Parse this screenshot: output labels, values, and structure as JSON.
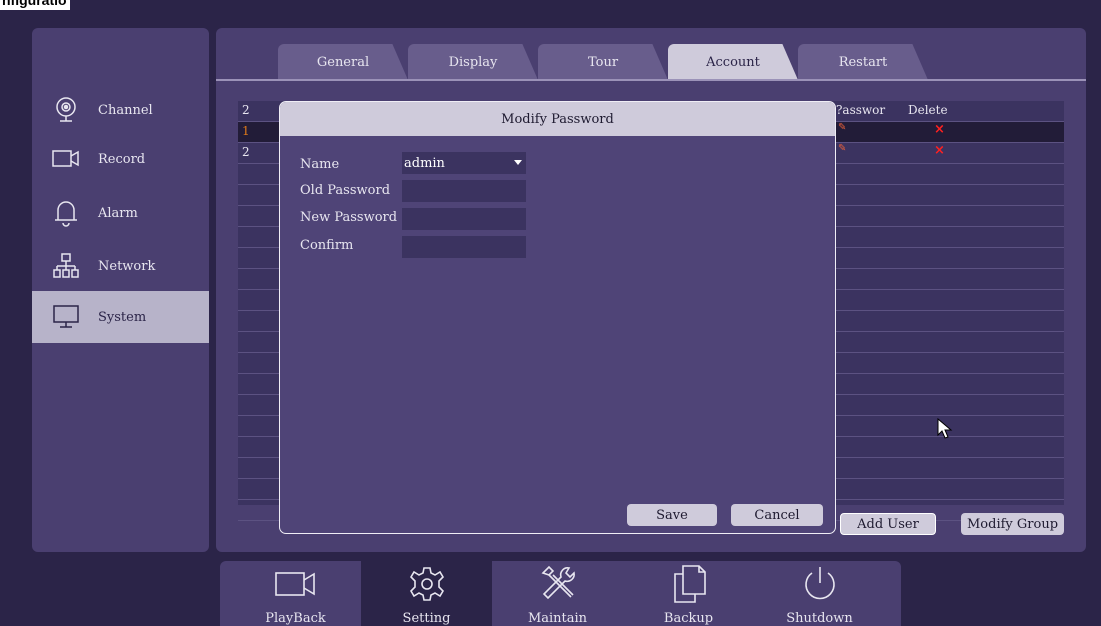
{
  "top_label": "nfiguratio",
  "sidebar": {
    "items": [
      {
        "label": "Channel",
        "icon": "webcam-icon"
      },
      {
        "label": "Record",
        "icon": "video-camera-icon"
      },
      {
        "label": "Alarm",
        "icon": "bell-icon"
      },
      {
        "label": "Network",
        "icon": "network-icon"
      },
      {
        "label": "System",
        "icon": "monitor-icon",
        "active": true
      }
    ]
  },
  "tabs": [
    {
      "label": "General"
    },
    {
      "label": "Display"
    },
    {
      "label": "Tour"
    },
    {
      "label": "Account",
      "active": true
    },
    {
      "label": "Restart"
    }
  ],
  "table": {
    "header": {
      "index": "2",
      "password_col": "?asswor",
      "delete_col": "Delete"
    },
    "rows": [
      {
        "index": "1",
        "selected": true,
        "has_edit": true,
        "delete": "×"
      },
      {
        "index": "2",
        "selected": false,
        "has_edit": true,
        "delete": "×"
      }
    ]
  },
  "buttons": {
    "add_user": "Add User",
    "modify_group": "Modify Group"
  },
  "modal": {
    "title": "Modify Password",
    "name_label": "Name",
    "name_value": "admin",
    "old_password_label": "Old Password",
    "new_password_label": "New Password",
    "confirm_label": "Confirm",
    "save": "Save",
    "cancel": "Cancel"
  },
  "bottombar": {
    "items": [
      {
        "label": "PlayBack",
        "icon": "video-camera-icon"
      },
      {
        "label": "Setting",
        "icon": "gear-icon",
        "active": true
      },
      {
        "label": "Maintain",
        "icon": "tools-icon"
      },
      {
        "label": "Backup",
        "icon": "copy-icon"
      },
      {
        "label": "Shutdown",
        "icon": "power-icon"
      }
    ]
  },
  "colors": {
    "background": "#2b2448",
    "panel": "#4a3f70",
    "active_light": "#cfcbdb",
    "delete_red": "#ff2020",
    "index_orange": "#e07a1a"
  }
}
